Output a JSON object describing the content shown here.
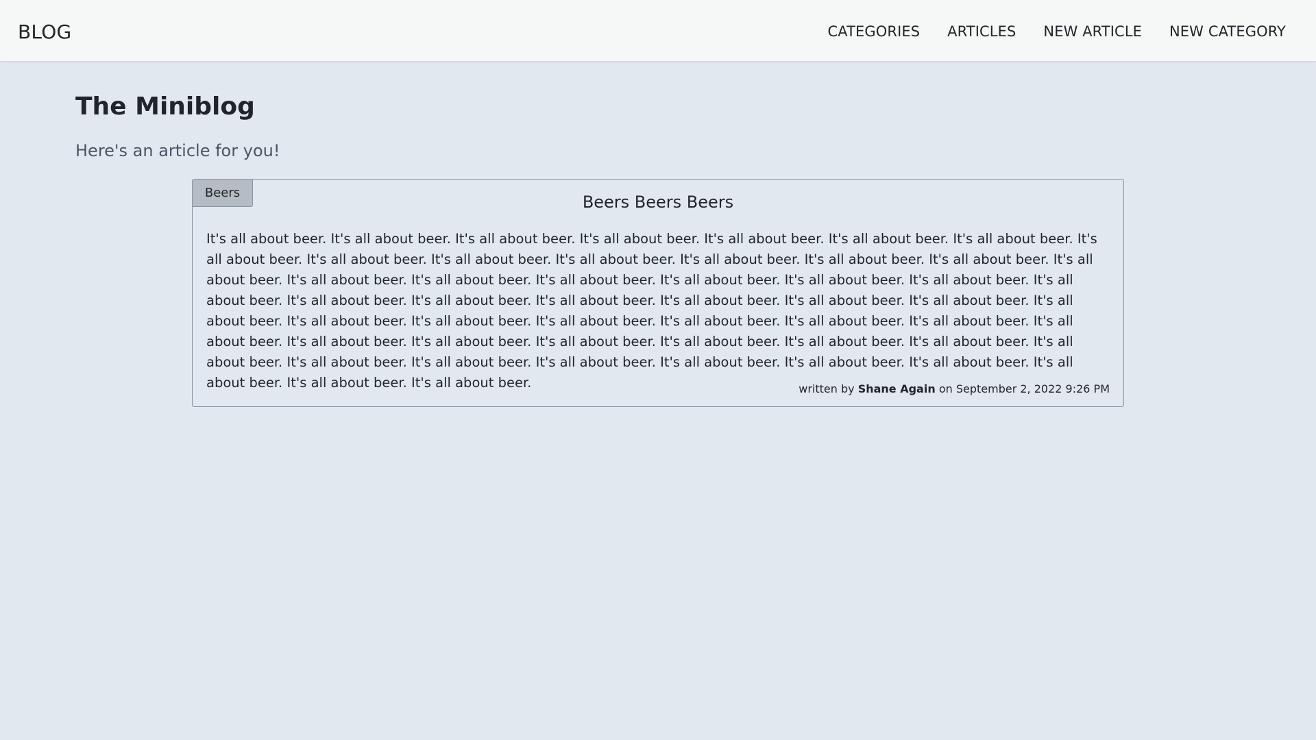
{
  "navbar": {
    "brand": "BLOG",
    "links": [
      {
        "label": "CATEGORIES"
      },
      {
        "label": "ARTICLES"
      },
      {
        "label": "NEW ARTICLE"
      },
      {
        "label": "NEW CATEGORY"
      }
    ]
  },
  "page": {
    "title": "The Miniblog",
    "subtitle": "Here's an article for you!"
  },
  "article": {
    "category": "Beers",
    "title": "Beers Beers Beers",
    "body": "It's all about beer. It's all about beer. It's all about beer. It's all about beer. It's all about beer. It's all about beer. It's all about beer. It's all about beer. It's all about beer. It's all about beer. It's all about beer. It's all about beer. It's all about beer. It's all about beer. It's all about beer. It's all about beer. It's all about beer. It's all about beer. It's all about beer. It's all about beer. It's all about beer. It's all about beer. It's all about beer. It's all about beer. It's all about beer. It's all about beer. It's all about beer. It's all about beer. It's all about beer. It's all about beer. It's all about beer. It's all about beer. It's all about beer. It's all about beer. It's all about beer. It's all about beer. It's all about beer. It's all about beer. It's all about beer. It's all about beer. It's all about beer. It's all about beer. It's all about beer. It's all about beer. It's all about beer. It's all about beer. It's all about beer. It's all about beer. It's all about beer. It's all about beer. It's all about beer. It's all about beer.",
    "meta_prefix": "written by",
    "author": "Shane Again",
    "date_prefix": "on",
    "date": "September 2, 2022 9:26 PM"
  }
}
